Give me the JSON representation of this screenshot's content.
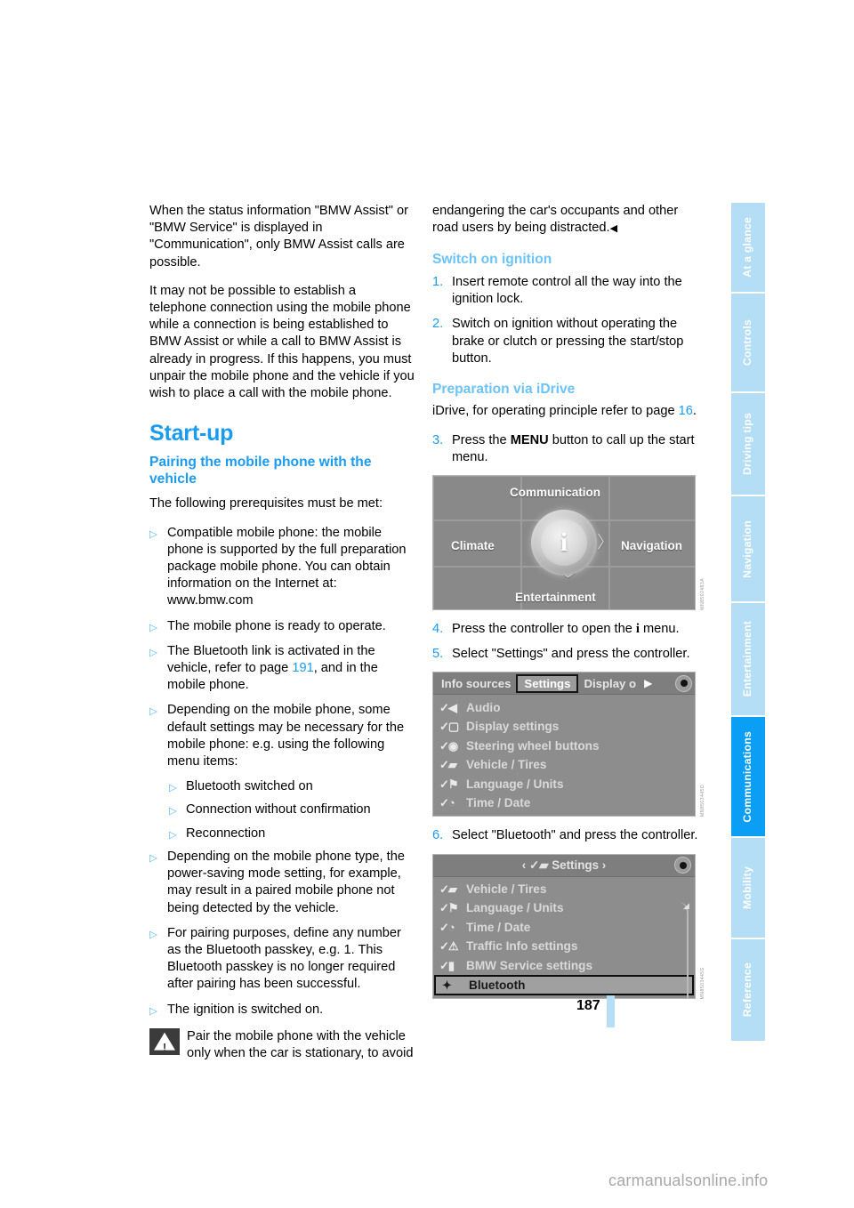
{
  "document": {
    "page_number": "187",
    "watermark": "carmanualsonline.info"
  },
  "left_column": {
    "paragraphs": [
      "When the status information \"BMW Assist\" or \"BMW Service\" is displayed in \"Communication\", only BMW Assist calls are possible.",
      "It may not be possible to establish a telephone connection using the mobile phone while a connection is being established to BMW Assist or while a call to BMW Assist is already in progress. If this happens, you must unpair the mobile phone and the vehicle if you wish to place a call with the mobile phone."
    ],
    "section_heading": "Start-up",
    "sub_heading": "Pairing the mobile phone with the vehicle",
    "intro": "The following prerequisites must be met:",
    "bullets": [
      {
        "text": "Compatible mobile phone: the mobile phone is supported by the full preparation package mobile phone. You can obtain information on the Internet at: www.bmw.com",
        "nested": false
      },
      {
        "text": "The mobile phone is ready to operate.",
        "nested": false
      },
      {
        "text_pre": "The Bluetooth link is activated in the vehicle, refer to page ",
        "page_ref": "191",
        "text_post": ", and in the mobile phone.",
        "nested": false
      },
      {
        "text": "Depending on the mobile phone, some default settings may be necessary for the mobile phone: e.g. using the following menu items:",
        "nested": false
      },
      {
        "text": "Bluetooth switched on",
        "nested": true
      },
      {
        "text": "Connection without confirmation",
        "nested": true
      },
      {
        "text": "Reconnection",
        "nested": true
      },
      {
        "text": "Depending on the mobile phone type, the power-saving mode setting, for example, may result in a paired mobile phone not being detected by the vehicle.",
        "nested": false
      },
      {
        "text": "For pairing purposes, define any number as the Bluetooth passkey, e.g. 1. This Bluetooth passkey is no longer required after pairing has been successful.",
        "nested": false
      },
      {
        "text": "The ignition is switched on.",
        "nested": false
      }
    ],
    "warning": {
      "icon": "warning-triangle-icon",
      "text": "Pair the mobile phone with the vehicle only when the car is stationary, to avoid"
    },
    "bullet_glyph": "▷"
  },
  "right_column": {
    "warning_continuation": "endangering the car's occupants and other road users by being distracted.",
    "warning_end_mark": "◀",
    "heading_switch_ignition": "Switch on ignition",
    "steps_ignition": [
      {
        "num": "1.",
        "text": "Insert remote control all the way into the ignition lock."
      },
      {
        "num": "2.",
        "text": "Switch on ignition without operating the brake or clutch or pressing the start/stop button."
      }
    ],
    "heading_preparation": "Preparation via iDrive",
    "idrive_intro_pre": "iDrive, for operating principle refer to page ",
    "idrive_intro_ref": "16",
    "idrive_intro_post": ".",
    "step3": {
      "num": "3.",
      "text_pre": "Press the ",
      "button": "MENU",
      "text_post": " button to call up the start menu."
    },
    "step4": {
      "num": "4.",
      "text_pre": "Press the controller to open the ",
      "symbol": "i",
      "text_post": " menu."
    },
    "step5": {
      "num": "5.",
      "text": "Select \"Settings\" and press the controller."
    },
    "step6": {
      "num": "6.",
      "text": "Select \"Bluetooth\" and press the controller."
    }
  },
  "figures": {
    "start_menu": {
      "code": "MN8502483A",
      "labels": {
        "top": "Communication",
        "left": "Climate",
        "right": "Navigation",
        "bottom": "Entertainment",
        "center": "i"
      },
      "chevrons": {
        "up": "︿",
        "down": "﹀",
        "left": "〈",
        "right": "〉"
      }
    },
    "settings_menu": {
      "code": "MN8503445D",
      "tabs": [
        {
          "label": "Info sources",
          "selected": false
        },
        {
          "label": "Settings",
          "selected": true
        },
        {
          "label": "Display o",
          "selected": false
        }
      ],
      "tab_arrow": "▶",
      "joystick": "joystick-indicator-icon",
      "items": [
        {
          "icon": "audio-icon",
          "label": "Audio"
        },
        {
          "icon": "display-icon",
          "label": "Display settings"
        },
        {
          "icon": "steering-wheel-icon",
          "label": "Steering wheel buttons"
        },
        {
          "icon": "vehicle-icon",
          "label": "Vehicle / Tires"
        },
        {
          "icon": "flag-icon",
          "label": "Language / Units"
        },
        {
          "icon": "clock-icon",
          "label": "Time / Date"
        }
      ]
    },
    "settings_submenu": {
      "code": "MN8503445G",
      "title": "Settings",
      "title_arrows": {
        "left": "‹",
        "right": "›"
      },
      "items": [
        {
          "icon": "vehicle-icon",
          "label": "Vehicle / Tires",
          "highlighted": false
        },
        {
          "icon": "flag-icon",
          "label": "Language / Units",
          "highlighted": false
        },
        {
          "icon": "clock-icon",
          "label": "Time / Date",
          "highlighted": false
        },
        {
          "icon": "traffic-warning-icon",
          "label": "Traffic Info settings",
          "highlighted": false
        },
        {
          "icon": "service-icon",
          "label": "BMW Service settings",
          "highlighted": false
        },
        {
          "icon": "bluetooth-icon",
          "label": "Bluetooth",
          "highlighted": true
        }
      ]
    }
  },
  "index_tabs": [
    {
      "label": "At a glance",
      "active": false
    },
    {
      "label": "Controls",
      "active": false
    },
    {
      "label": "Driving tips",
      "active": false
    },
    {
      "label": "Navigation",
      "active": false
    },
    {
      "label": "Entertainment",
      "active": false
    },
    {
      "label": "Communications",
      "active": true
    },
    {
      "label": "Mobility",
      "active": false
    },
    {
      "label": "Reference",
      "active": false
    }
  ],
  "colors": {
    "accent_blue": "#1a9bf0",
    "light_blue": "#6cc3f5",
    "tab_inactive": "#b4ddf6",
    "tab_active": "#0b9ef5"
  }
}
